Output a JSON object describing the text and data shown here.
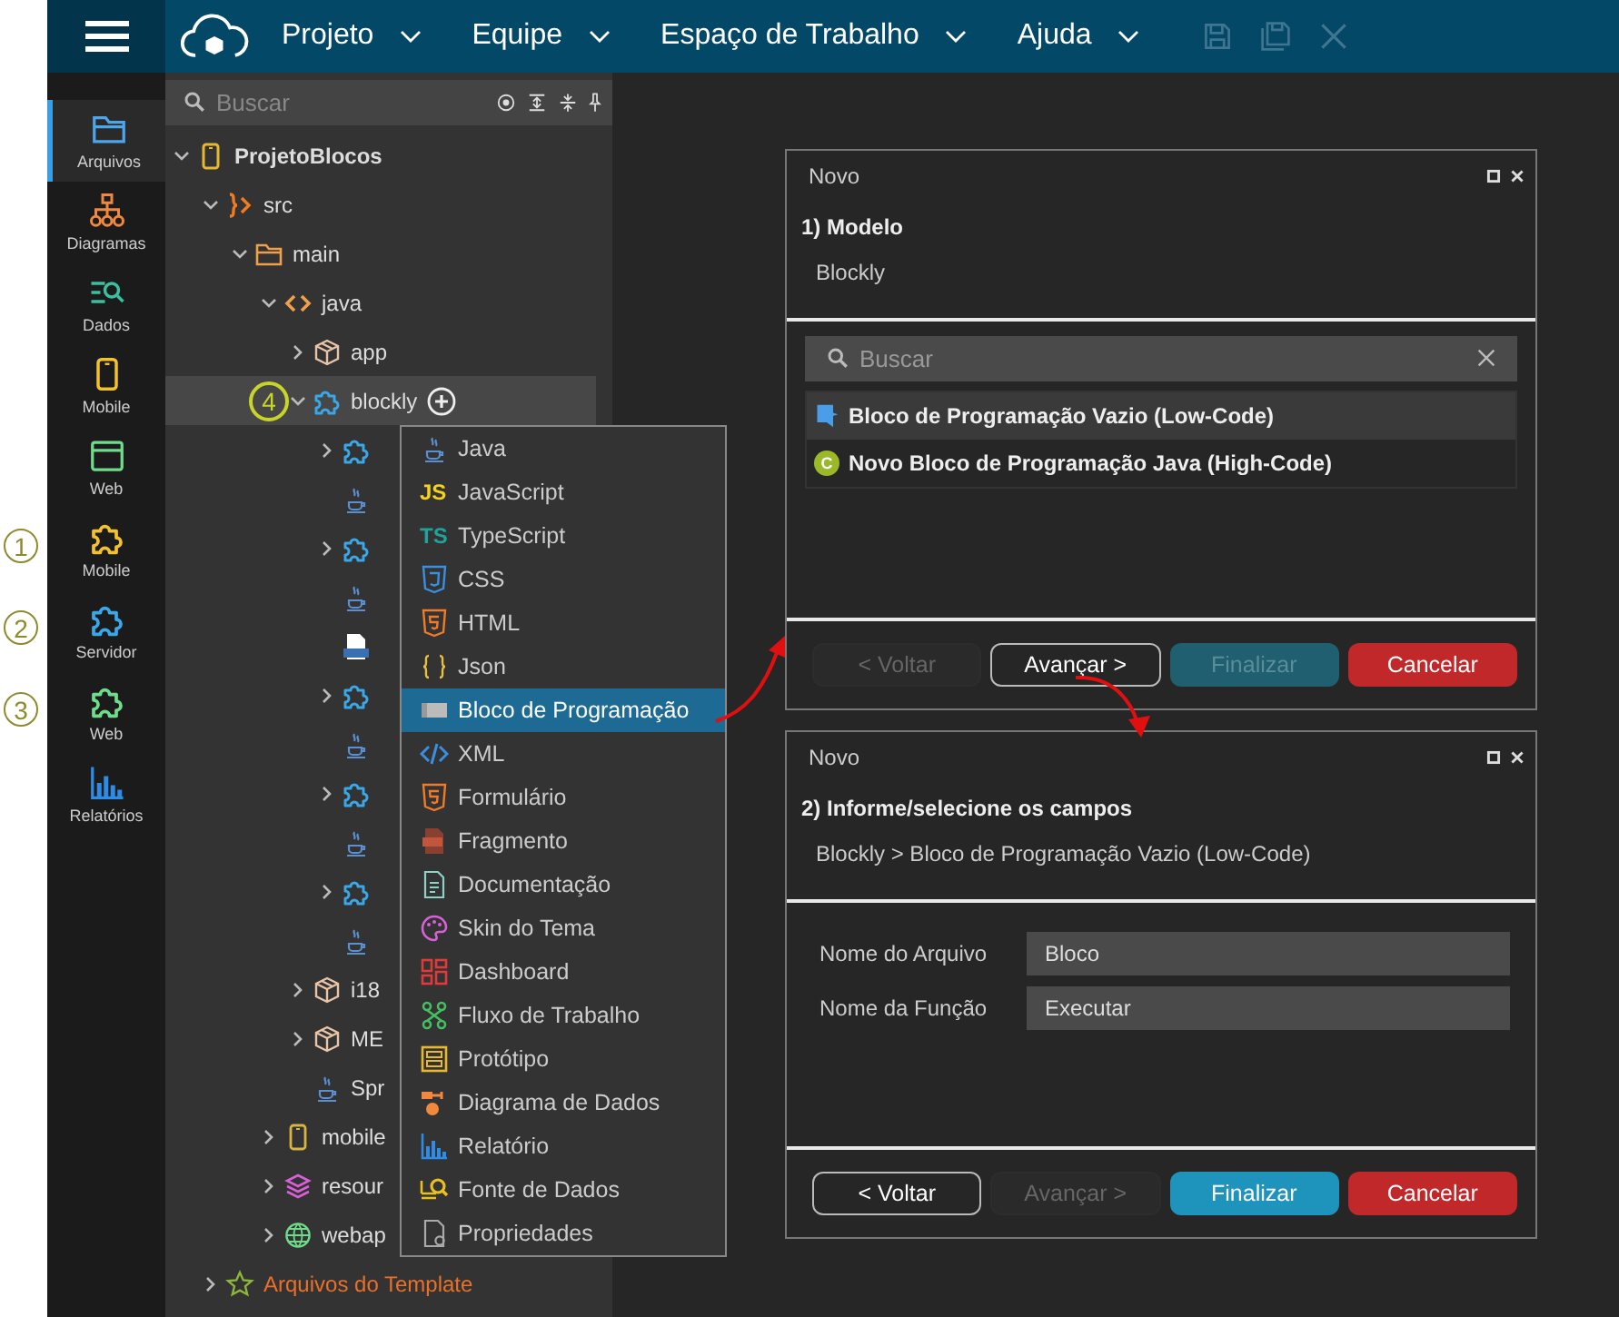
{
  "topbar": {
    "menus": [
      {
        "label": "Projeto"
      },
      {
        "label": "Equipe"
      },
      {
        "label": "Espaço de Trabalho"
      },
      {
        "label": "Ajuda"
      }
    ]
  },
  "sidebar": {
    "items": [
      {
        "label": "Arquivos",
        "kind": "folder",
        "color": "#4da6e8",
        "selected": true
      },
      {
        "label": "Diagramas",
        "kind": "hierarchy",
        "color": "#f0883e",
        "selected": false
      },
      {
        "label": "Dados",
        "kind": "data",
        "color": "#3bbfa0",
        "selected": false
      },
      {
        "label": "Mobile",
        "kind": "phone",
        "color": "#f2c12e",
        "selected": false
      },
      {
        "label": "Web",
        "kind": "browser",
        "color": "#6fdc8c",
        "selected": false
      },
      {
        "label": "Mobile",
        "kind": "puzzle",
        "color": "#f2c12e",
        "selected": false,
        "badge": "1"
      },
      {
        "label": "Servidor",
        "kind": "puzzle",
        "color": "#3aa8e8",
        "selected": false,
        "badge": "2"
      },
      {
        "label": "Web",
        "kind": "puzzle",
        "color": "#6fdc8c",
        "selected": false,
        "badge": "3"
      },
      {
        "label": "Relatórios",
        "kind": "chart",
        "color": "#2d8ce6",
        "selected": false
      }
    ]
  },
  "explorer": {
    "search": {
      "placeholder": "Buscar"
    },
    "tree": [
      {
        "label": "ProjetoBlocos",
        "kind": "project",
        "expanded": true,
        "selected": false,
        "children": [
          {
            "label": "src",
            "kind": "source",
            "expanded": true,
            "selected": false,
            "children": [
              {
                "label": "main",
                "kind": "folder",
                "expanded": true,
                "selected": false,
                "children": [
                  {
                    "label": "java",
                    "kind": "code",
                    "expanded": true,
                    "selected": false,
                    "children": [
                      {
                        "label": "app",
                        "kind": "package",
                        "expanded": false,
                        "selected": false
                      },
                      {
                        "label": "blockly",
                        "kind": "puzzle",
                        "expanded": true,
                        "selected": true,
                        "badge": "4",
                        "children": [
                          {
                            "kind": "puzzle",
                            "expanded": false,
                            "selected": false
                          },
                          {
                            "kind": "java",
                            "selected": false
                          },
                          {
                            "kind": "puzzle",
                            "expanded": false,
                            "selected": false
                          },
                          {
                            "kind": "java",
                            "selected": false
                          },
                          {
                            "kind": "json",
                            "selected": false
                          },
                          {
                            "kind": "puzzle",
                            "expanded": false,
                            "selected": false
                          },
                          {
                            "kind": "java",
                            "selected": false
                          },
                          {
                            "kind": "puzzle",
                            "expanded": false,
                            "selected": false
                          },
                          {
                            "kind": "java",
                            "selected": false
                          },
                          {
                            "kind": "puzzle",
                            "expanded": false,
                            "selected": false
                          },
                          {
                            "kind": "java",
                            "selected": false
                          }
                        ]
                      },
                      {
                        "label": "i18",
                        "kind": "package",
                        "expanded": false,
                        "selected": false
                      },
                      {
                        "label": "ME",
                        "kind": "package",
                        "expanded": false,
                        "selected": false
                      },
                      {
                        "label": "Spr",
                        "kind": "java",
                        "selected": false
                      }
                    ]
                  },
                  {
                    "label": "mobile",
                    "kind": "phone",
                    "expanded": false,
                    "selected": false
                  },
                  {
                    "label": "resour",
                    "kind": "layers",
                    "expanded": false,
                    "selected": false
                  },
                  {
                    "label": "webap",
                    "kind": "globe",
                    "expanded": false,
                    "selected": false
                  }
                ]
              }
            ]
          },
          {
            "label": "Arquivos do Template",
            "kind": "template",
            "expanded": false,
            "selected": false
          }
        ]
      }
    ]
  },
  "context_menu": {
    "items": [
      {
        "label": "Java",
        "kind": "java",
        "selected": false
      },
      {
        "label": "JavaScript",
        "kind": "js",
        "icon_text": "JS",
        "selected": false
      },
      {
        "label": "TypeScript",
        "kind": "ts",
        "icon_text": "TS",
        "selected": false
      },
      {
        "label": "CSS",
        "kind": "css",
        "selected": false
      },
      {
        "label": "HTML",
        "kind": "html",
        "selected": false
      },
      {
        "label": "Json",
        "kind": "braces",
        "selected": false
      },
      {
        "label": "Bloco de Programação",
        "kind": "block",
        "selected": true
      },
      {
        "label": "XML",
        "kind": "xml",
        "selected": false
      },
      {
        "label": "Formulário",
        "kind": "html",
        "selected": false
      },
      {
        "label": "Fragmento",
        "kind": "fragment",
        "selected": false
      },
      {
        "label": "Documentação",
        "kind": "doc",
        "selected": false
      },
      {
        "label": "Skin do Tema",
        "kind": "palette",
        "selected": false
      },
      {
        "label": "Dashboard",
        "kind": "dashboard",
        "selected": false
      },
      {
        "label": "Fluxo de Trabalho",
        "kind": "flow",
        "selected": false
      },
      {
        "label": "Protótipo",
        "kind": "prototype",
        "selected": false
      },
      {
        "label": "Diagrama de Dados",
        "kind": "diagram",
        "selected": false
      },
      {
        "label": "Relatório",
        "kind": "chart",
        "selected": false
      },
      {
        "label": "Fonte de Dados",
        "kind": "datasource",
        "selected": false
      },
      {
        "label": "Propriedades",
        "kind": "props",
        "selected": false
      }
    ]
  },
  "dialogs": [
    {
      "title": "Novo",
      "step": "1) Modelo",
      "path": "Blockly",
      "search": {
        "placeholder": "Buscar"
      },
      "options": [
        {
          "label": "Bloco de Programação Vazio (Low-Code)",
          "kind": "block",
          "selected": true
        },
        {
          "label": "Novo Bloco de Programação Java (High-Code)",
          "kind": "class",
          "icon_text": "C",
          "selected": false
        }
      ],
      "buttons": [
        {
          "label": "< Voltar",
          "kind": "outline",
          "disabled": true
        },
        {
          "label": "Avançar >",
          "kind": "outline",
          "disabled": false
        },
        {
          "label": "Finalizar",
          "kind": "primary",
          "disabled": true
        },
        {
          "label": "Cancelar",
          "kind": "danger",
          "disabled": false
        }
      ]
    },
    {
      "title": "Novo",
      "step": "2) Informe/selecione os campos",
      "path": "Blockly > Bloco de Programação Vazio (Low-Code)",
      "fields": [
        {
          "label": "Nome do Arquivo",
          "value": "Bloco"
        },
        {
          "label": "Nome da Função",
          "value": "Executar"
        }
      ],
      "buttons": [
        {
          "label": "< Voltar",
          "kind": "outline",
          "disabled": false
        },
        {
          "label": "Avançar >",
          "kind": "outline",
          "disabled": true
        },
        {
          "label": "Finalizar",
          "kind": "primary",
          "disabled": false
        },
        {
          "label": "Cancelar",
          "kind": "danger",
          "disabled": false
        }
      ]
    }
  ]
}
